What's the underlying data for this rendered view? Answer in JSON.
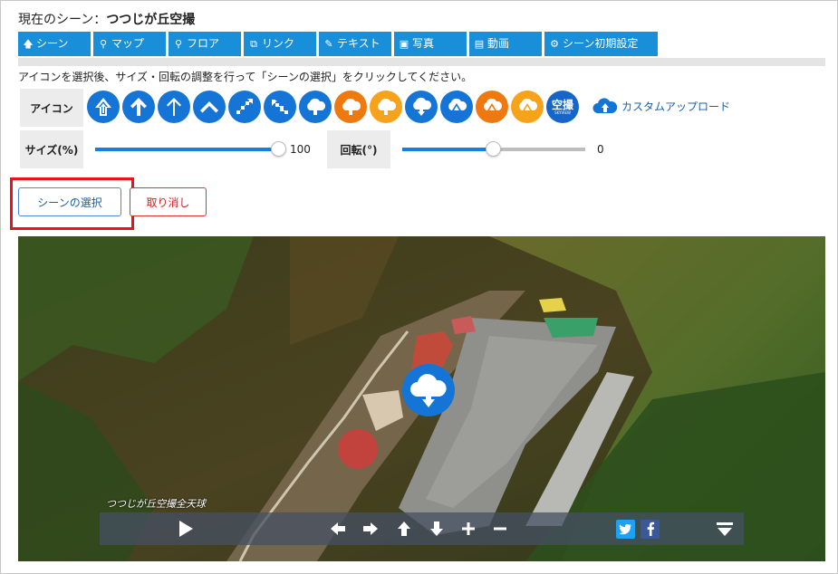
{
  "header": {
    "prefix": "現在のシーン：",
    "scene_name": "つつじが丘空撮"
  },
  "tabs": [
    {
      "label": "シーン",
      "icon": "arrow-up-icon"
    },
    {
      "label": "マップ",
      "icon": "map-marker-icon"
    },
    {
      "label": "フロア",
      "icon": "map-marker-icon"
    },
    {
      "label": "リンク",
      "icon": "external-link-icon"
    },
    {
      "label": "テキスト",
      "icon": "edit-icon"
    },
    {
      "label": "写真",
      "icon": "image-icon"
    },
    {
      "label": "動画",
      "icon": "film-icon"
    },
    {
      "label": "シーン初期設定",
      "icon": "gear-icon"
    }
  ],
  "instruction": "アイコンを選択後、サイズ・回転の調整を行って「シーンの選択」をクリックしてください。",
  "icon_picker": {
    "label": "アイコン",
    "icons": [
      "arrow-up-bold-icon",
      "arrow-up-circle-icon",
      "arrow-up-thin-icon",
      "chevron-up-icon",
      "step-up-right-icon",
      "step-down-left-icon",
      "cloud-up-icon",
      "cloud-up-orange-icon",
      "cloud-up-yellow-icon",
      "cloud-down-icon",
      "mountain-blue-icon",
      "mountain-orange-icon",
      "mountain-yellow-icon",
      "skyview-icon"
    ],
    "sky_text": "空撮",
    "sky_sub": "SKYVIEW",
    "upload_label": "カスタムアップロード"
  },
  "size": {
    "label": "サイズ(%)",
    "value": "100",
    "fraction": 1.0
  },
  "rotation": {
    "label": "回転(°)",
    "value": "0",
    "fraction": 0.5
  },
  "buttons": {
    "select": "シーンの選択",
    "cancel": "取り消し"
  },
  "panorama": {
    "caption": "つつじが丘空撮全天球",
    "controls": [
      "play-icon",
      "arrow-left-icon",
      "arrow-right-icon",
      "arrow-up-icon",
      "arrow-down-icon",
      "zoom-in-icon",
      "zoom-out-icon",
      "twitter-icon",
      "facebook-icon",
      "menu-collapse-icon"
    ]
  },
  "colors": {
    "tab": "#1a8fd9",
    "icon_blue": "#1475d6",
    "icon_orange": "#f0790f",
    "icon_yellow": "#f6a21b",
    "highlight": "#e8141c"
  }
}
